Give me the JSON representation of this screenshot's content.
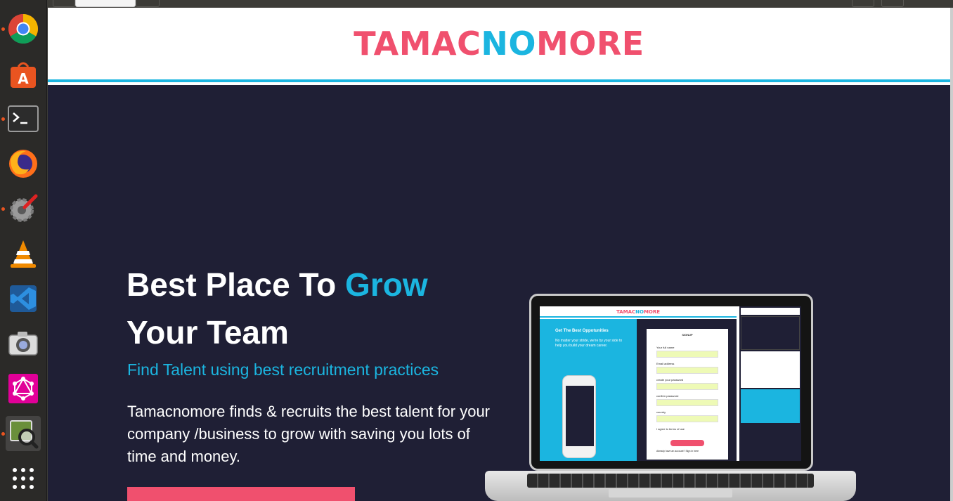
{
  "dock": {
    "items": [
      {
        "name": "chrome-icon",
        "running": true
      },
      {
        "name": "software-center-icon",
        "running": false
      },
      {
        "name": "terminal-icon",
        "running": true
      },
      {
        "name": "firefox-icon",
        "running": false
      },
      {
        "name": "system-settings-icon",
        "running": true
      },
      {
        "name": "vlc-icon",
        "running": false
      },
      {
        "name": "vscode-icon",
        "running": false
      },
      {
        "name": "screenshot-icon",
        "running": false
      },
      {
        "name": "graphql-icon",
        "running": false
      },
      {
        "name": "image-viewer-icon",
        "running": true
      },
      {
        "name": "app-grid-icon",
        "running": false
      }
    ]
  },
  "site": {
    "logo_left": "TAMAC",
    "logo_mid": "NO",
    "logo_right": "MORE",
    "colors": {
      "brand_pink": "#f0506e",
      "brand_cyan": "#1bb5e0",
      "hero_bg": "#1f1f35"
    }
  },
  "hero": {
    "title_part1": "Best Place To ",
    "title_accent": "Grow",
    "title_part2": "Your Team",
    "subtitle": "Find Talent using best recruitment practices",
    "description": "Tamacnomore finds & recruits the best talent for your company /business to grow with saving you lots of time and money."
  },
  "mockup": {
    "logo_left": "TAMAC",
    "logo_mid": "NO",
    "logo_right": "MORE",
    "left_title": "Get The Best Oppotunities",
    "left_text": "No matter your stride, we're by your side to help you build your dream career.",
    "form_title": "SIGNUP",
    "fields": [
      "Your full name",
      "Email address",
      "create your password",
      "confirm password",
      "country"
    ],
    "submit_label": "continue",
    "terms_text": "I agree to terms of use",
    "login_text": "Already have an account? Sign in here"
  }
}
